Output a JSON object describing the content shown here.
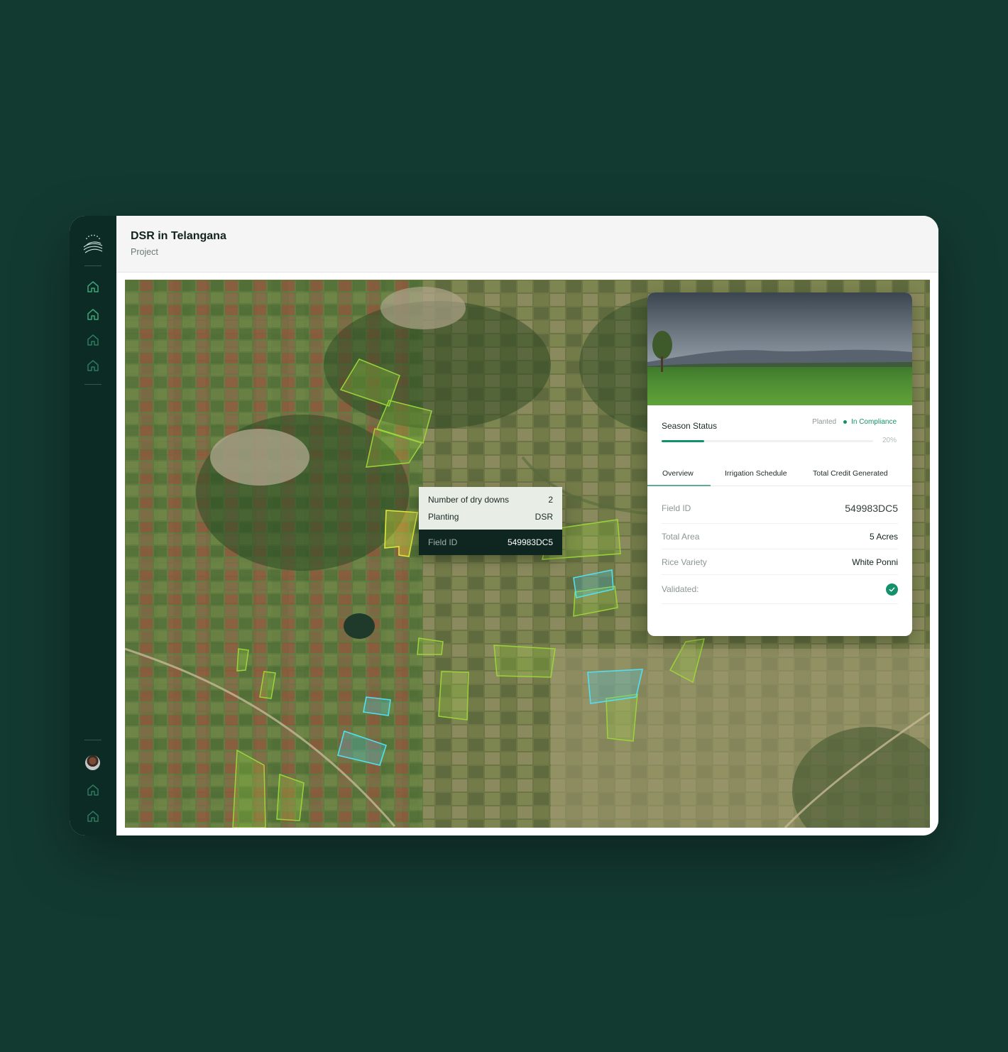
{
  "header": {
    "title": "DSR in Telangana",
    "subtitle": "Project"
  },
  "sidebar": {
    "logo": "farm-logo-icon",
    "nav_top": [
      "home-icon",
      "home-icon",
      "home-icon",
      "home-icon"
    ],
    "nav_bottom": [
      "avatar",
      "home-icon",
      "home-icon"
    ],
    "accent": "#3fa47a"
  },
  "tooltip": {
    "rows": [
      {
        "label": "Number of dry downs",
        "value": "2"
      },
      {
        "label": "Planting",
        "value": "DSR"
      }
    ],
    "field_id_label": "Field ID",
    "field_id_value": "549983DC5"
  },
  "card": {
    "season_status_label": "Season Status",
    "planted_label": "Planted",
    "compliance_label": "In Compliance",
    "progress": 0.2,
    "progress_label": "20%",
    "tabs": [
      "Overview",
      "Irrigation Schedule",
      "Total Credit Generated"
    ],
    "active_tab": "Overview",
    "details": {
      "field_id": {
        "label": "Field ID",
        "value": "549983DC5"
      },
      "total_area": {
        "label": "Total Area",
        "value": "5 Acres"
      },
      "rice_variety": {
        "label": "Rice Variety",
        "value": "White Ponni"
      },
      "validated": {
        "label": "Validated:",
        "value": true
      }
    }
  },
  "colors": {
    "background": "#133a31",
    "sidebar": "#0b2b24",
    "accent_green": "#14916b",
    "field_outline_green": "#9bd43a",
    "field_outline_cyan": "#52e0f0",
    "field_outline_yellow": "#e2e63a"
  }
}
